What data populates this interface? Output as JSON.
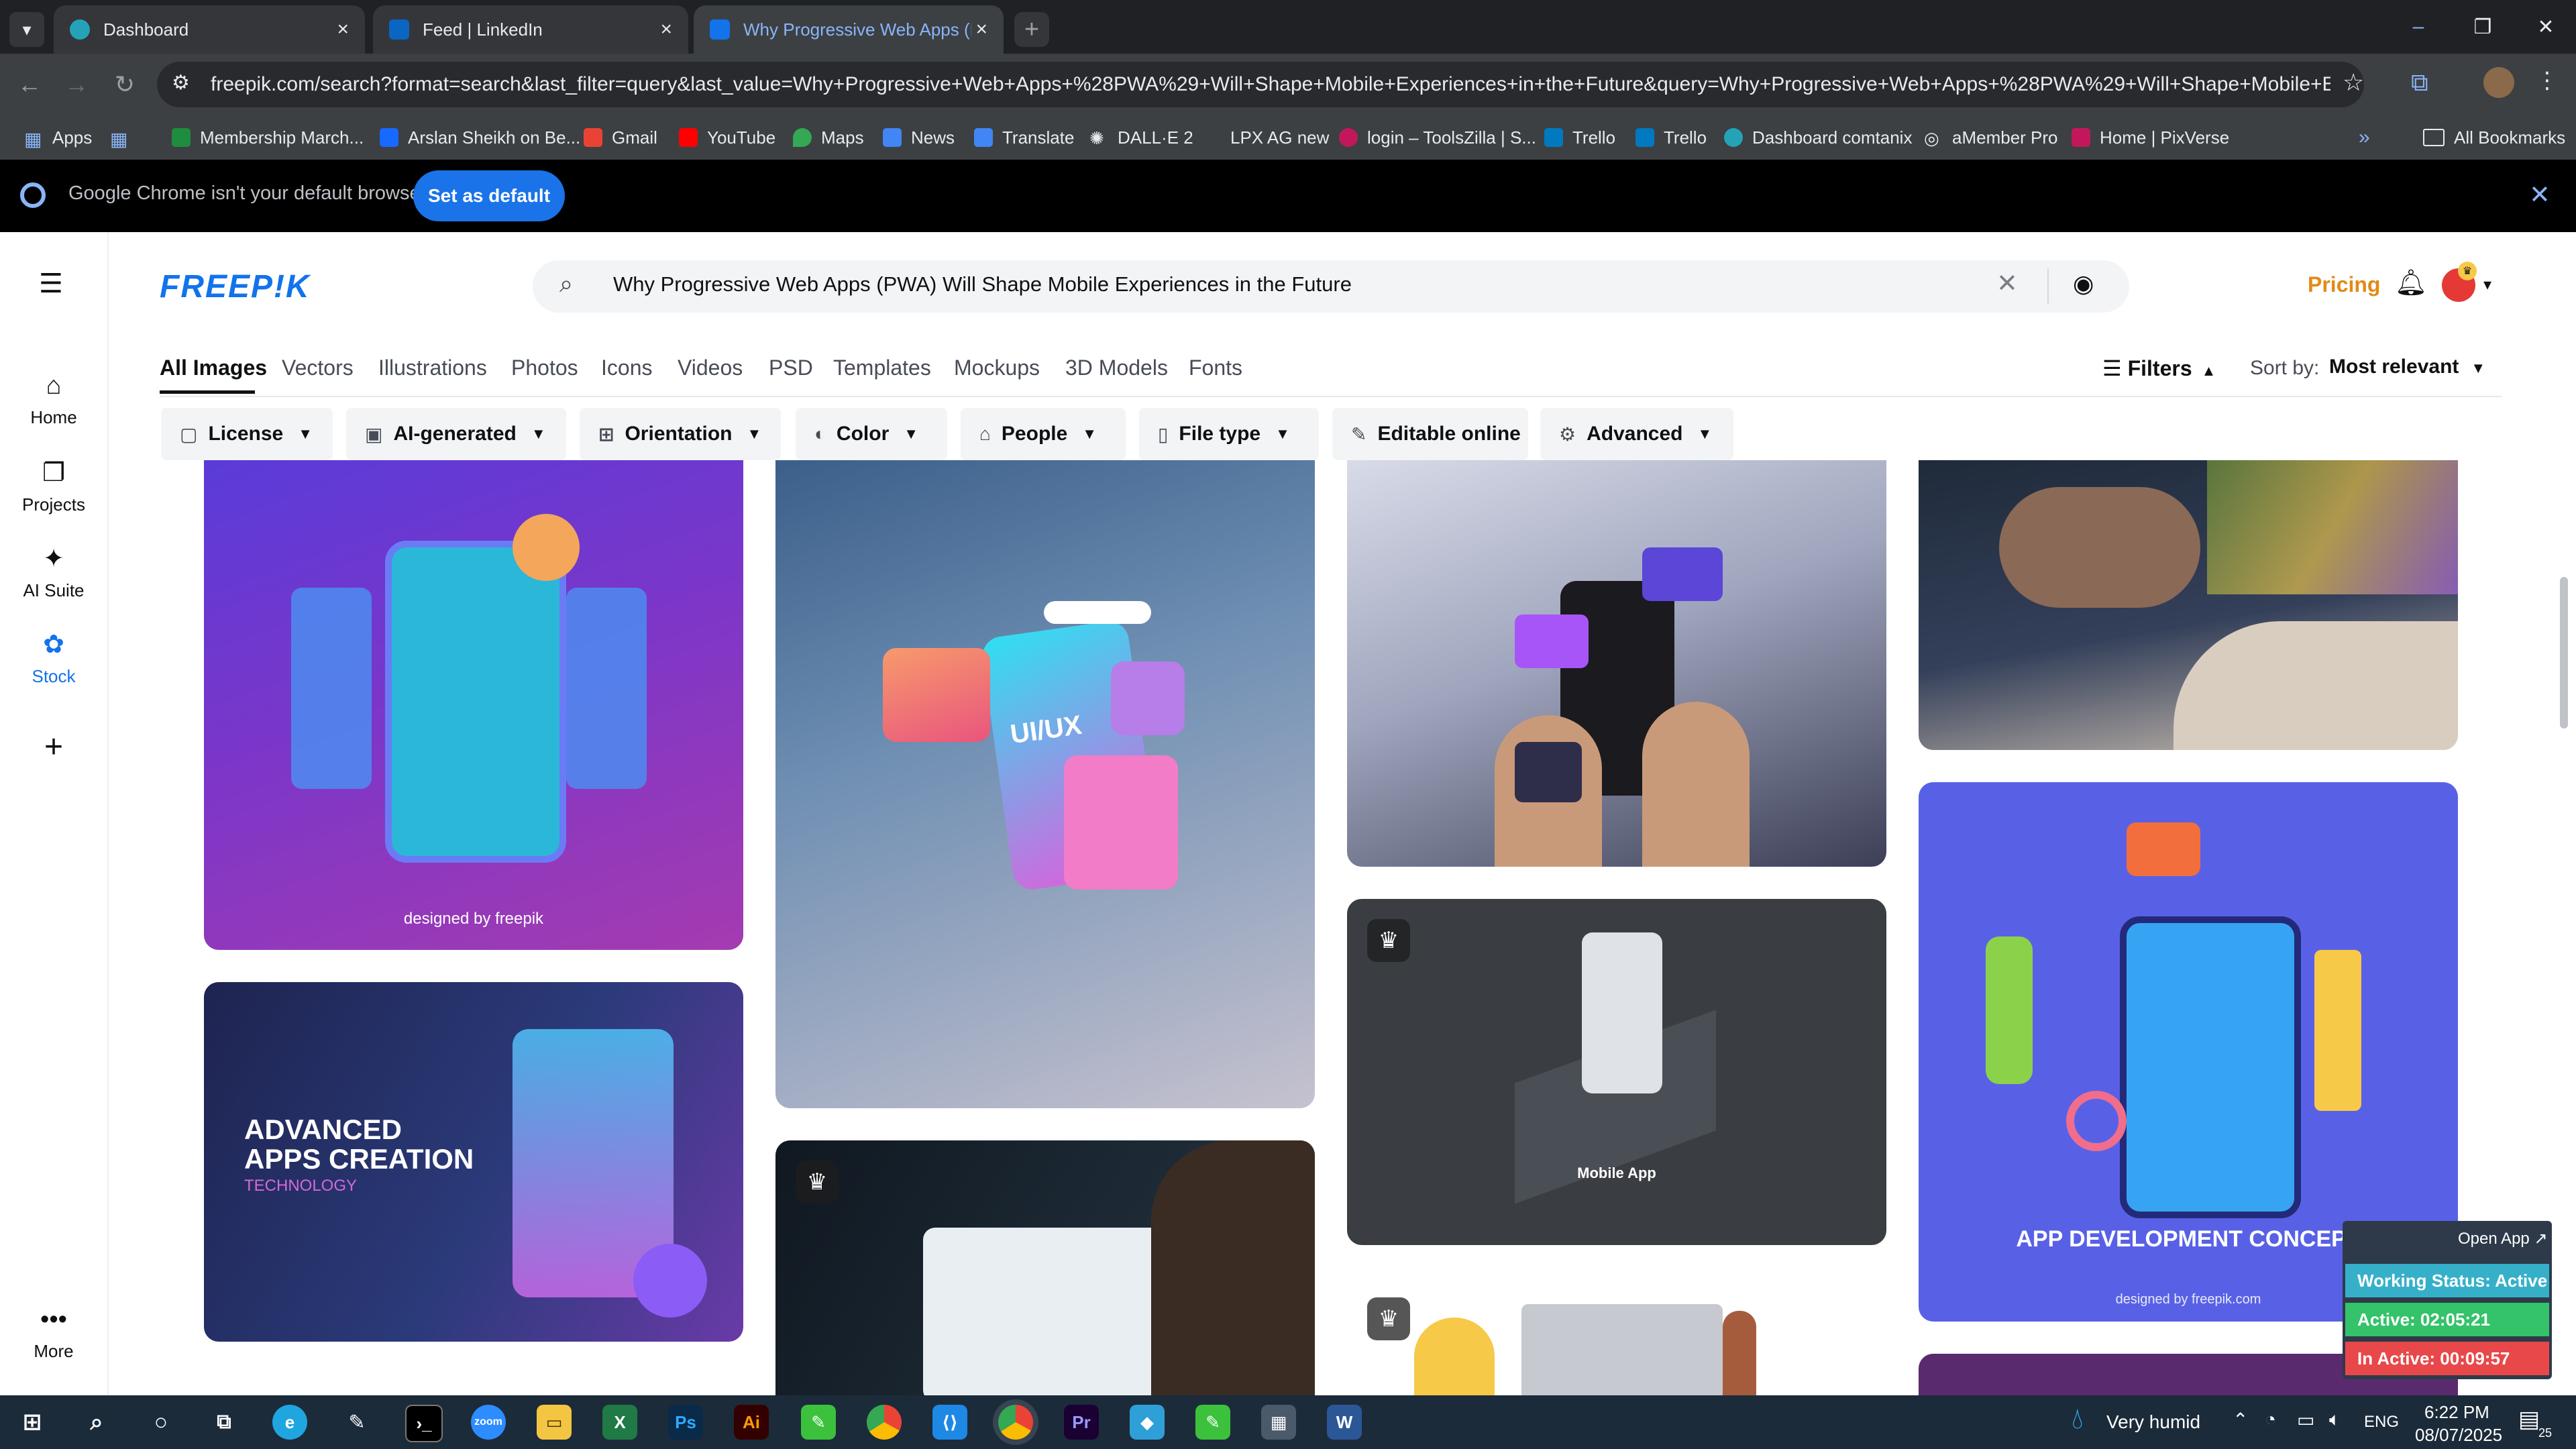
{
  "browser": {
    "tabs": [
      {
        "label": "Dashboard"
      },
      {
        "label": "Feed | LinkedIn"
      },
      {
        "label": "Why Progressive Web Apps (PW"
      }
    ],
    "url": "freepik.com/search?format=search&last_filter=query&last_value=Why+Progressive+Web+Apps+%28PWA%29+Will+Shape+Mobile+Experiences+in+the+Future&query=Why+Progressive+Web+Apps+%28PWA%29+Will+Shape+Mobile+Experiences+in...",
    "bookmarks": [
      {
        "label": "Apps"
      },
      {
        "label": "Membership March..."
      },
      {
        "label": "Arslan Sheikh on Be..."
      },
      {
        "label": "Gmail"
      },
      {
        "label": "YouTube"
      },
      {
        "label": "Maps"
      },
      {
        "label": "News"
      },
      {
        "label": "Translate"
      },
      {
        "label": "DALL·E 2"
      },
      {
        "label": "LPX AG new"
      },
      {
        "label": "login – ToolsZilla | S..."
      },
      {
        "label": "Trello"
      },
      {
        "label": "Trello"
      },
      {
        "label": "Dashboard comtanix"
      },
      {
        "label": "aMember Pro"
      },
      {
        "label": "Home | PixVerse"
      }
    ],
    "all_bookmarks": "All Bookmarks",
    "infobar_text": "Google Chrome isn't your default browser",
    "set_default": "Set as default"
  },
  "freepik": {
    "logo": "FREEP!K",
    "search_query": "Why Progressive Web Apps (PWA) Will Shape Mobile Experiences in the Future",
    "pricing": "Pricing",
    "nav": [
      {
        "label": "Home"
      },
      {
        "label": "Projects"
      },
      {
        "label": "AI Suite"
      },
      {
        "label": "Stock"
      },
      {
        "label": "More"
      }
    ],
    "categories": [
      "All Images",
      "Vectors",
      "Illustrations",
      "Photos",
      "Icons",
      "Videos",
      "PSD",
      "Templates",
      "Mockups",
      "3D Models",
      "Fonts"
    ],
    "filters_label": "Filters",
    "sort_label": "Sort by:",
    "sort_value": "Most relevant",
    "filter_chips": [
      "License",
      "AI-generated",
      "Orientation",
      "Color",
      "People",
      "File type",
      "Editable online",
      "Advanced"
    ],
    "tiles": {
      "t1_caption": "designed by freepik",
      "t2_title1": "ADVANCED",
      "t2_title2": "APPS CREATION",
      "t2_sub": "TECHNOLOGY",
      "t3_text": "UI/UX",
      "t6_caption": "Mobile App",
      "t9_title": "APP DEVELOPMENT CONCEPT",
      "t9_caption": "designed by freepik.com"
    }
  },
  "overlay": {
    "open_app": "Open App ↗",
    "working_status": "Working Status: Active",
    "active": "Active: 02:05:21",
    "inactive": "In Active: 00:09:57"
  },
  "taskbar": {
    "weather": "Very humid",
    "language": "ENG",
    "time": "6:22 PM",
    "date": "08/07/2025",
    "notifications": "25"
  }
}
